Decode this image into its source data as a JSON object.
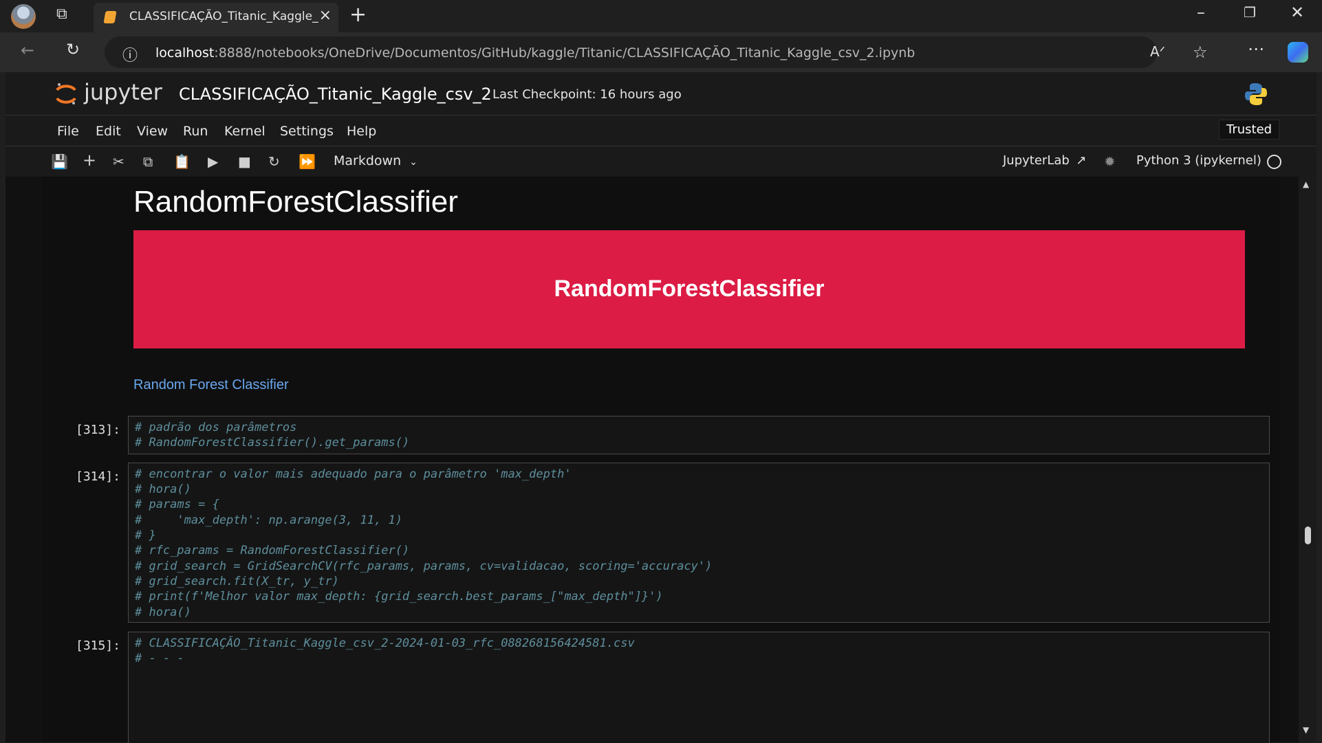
{
  "browser": {
    "tab_title": "CLASSIFICAÇÃO_Titanic_Kaggle_",
    "url_host": "localhost",
    "url_path": ":8888/notebooks/OneDrive/Documentos/GitHub/kaggle/Titanic/CLASSIFICAÇÃO_Titanic_Kaggle_csv_2.ipynb"
  },
  "jupyter": {
    "logo_text": "jupyter",
    "notebook_title": "CLASSIFICAÇÃO_Titanic_Kaggle_csv_2",
    "checkpoint": "Last Checkpoint: 16 hours ago",
    "menu": [
      "File",
      "Edit",
      "View",
      "Run",
      "Kernel",
      "Settings",
      "Help"
    ],
    "trusted": "Trusted",
    "cell_type": "Markdown",
    "jupyterlab": "JupyterLab",
    "kernel": "Python 3 (ipykernel)"
  },
  "notebook": {
    "heading": "RandomForestClassifier",
    "banner": "RandomForestClassifier",
    "link": "Random Forest Classifier",
    "cells": [
      {
        "prompt": "[313]:",
        "lines": [
          "# padrão dos parâmetros",
          "# RandomForestClassifier().get_params()"
        ]
      },
      {
        "prompt": "[314]:",
        "lines": [
          "# encontrar o valor mais adequado para o parâmetro 'max_depth'",
          "# hora()",
          "# params = {",
          "#     'max_depth': np.arange(3, 11, 1)",
          "# }",
          "# rfc_params = RandomForestClassifier()",
          "# grid_search = GridSearchCV(rfc_params, params, cv=validacao, scoring='accuracy')",
          "# grid_search.fit(X_tr, y_tr)",
          "# print(f'Melhor valor max_depth: {grid_search.best_params_[\"max_depth\"]}')",
          "# hora()"
        ]
      },
      {
        "prompt": "[315]:",
        "lines": [
          "# CLASSIFICAÇÃO_Titanic_Kaggle_csv_2-2024-01-03_rfc_088268156424581.csv",
          "# - - -"
        ]
      }
    ]
  },
  "colors": {
    "banner": "#dc1c45",
    "link": "#6aa9ef",
    "code_comment": "#5e8f9d",
    "jupyter_orange": "#f37726"
  }
}
